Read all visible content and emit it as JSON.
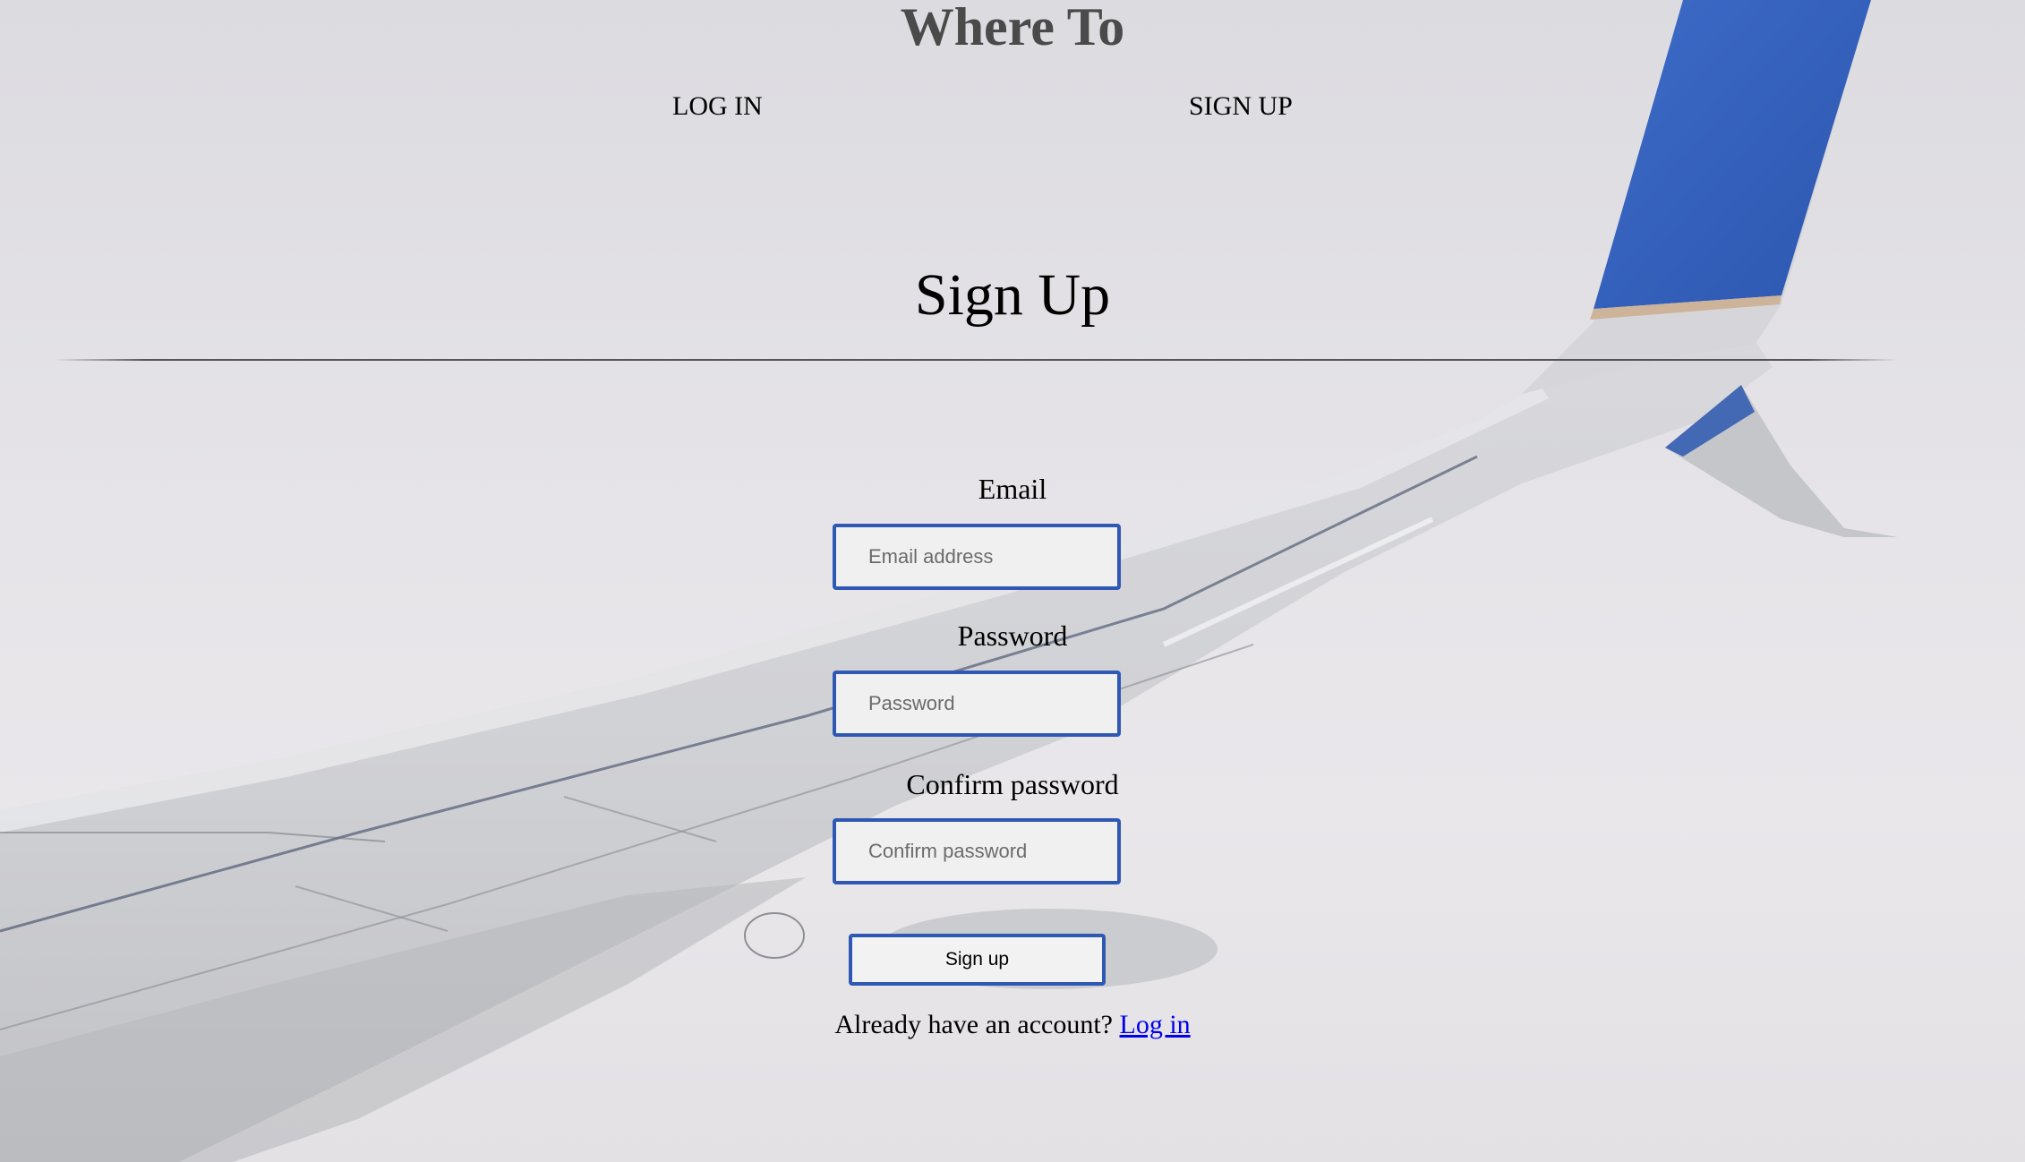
{
  "header": {
    "site_title": "Where To",
    "nav": {
      "login_label": "LOG IN",
      "signup_label": "SIGN UP"
    }
  },
  "main": {
    "heading": "Sign Up",
    "form": {
      "email": {
        "label": "Email",
        "placeholder": "Email address",
        "value": ""
      },
      "password": {
        "label": "Password",
        "placeholder": "Password",
        "value": ""
      },
      "confirm_password": {
        "label": "Confirm password",
        "placeholder": "Confirm password",
        "value": ""
      },
      "submit_label": "Sign up"
    },
    "footer": {
      "prompt": "Already have an account?",
      "link_label": "Log in"
    }
  },
  "colors": {
    "input_border": "#2f58b5",
    "link": "#0000ee",
    "title": "#4a4a4a"
  },
  "icons": {
    "background": "airplane-wing-photo"
  }
}
